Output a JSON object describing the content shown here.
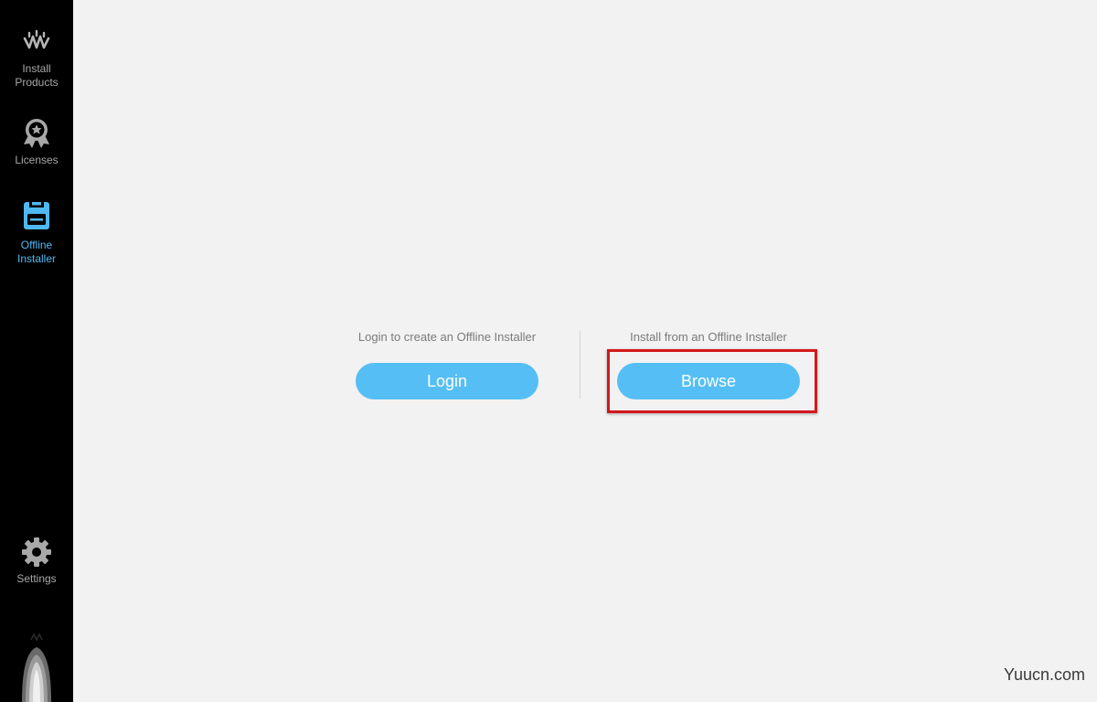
{
  "sidebar": {
    "items": [
      {
        "id": "install",
        "label": "Install\nProducts",
        "icon": "waves-logo-icon",
        "active": false
      },
      {
        "id": "licenses",
        "label": "Licenses",
        "icon": "license-badge-icon",
        "active": false
      },
      {
        "id": "offline",
        "label": "Offline\nInstaller",
        "icon": "floppy-disk-icon",
        "active": true
      },
      {
        "id": "settings",
        "label": "Settings",
        "icon": "gear-icon",
        "active": false
      }
    ],
    "footer_logo": "waves-brand-logo"
  },
  "main": {
    "login_panel": {
      "caption": "Login to create an Offline Installer",
      "button_label": "Login"
    },
    "browse_panel": {
      "caption": "Install from an Offline Installer",
      "button_label": "Browse"
    }
  },
  "annotation": {
    "highlight_color": "#d4181c"
  },
  "watermark": "Yuucn.com",
  "colors": {
    "accent": "#55bff5",
    "active_label": "#4fb8f0",
    "sidebar_bg": "#000000",
    "main_bg": "#f2f2f2"
  }
}
